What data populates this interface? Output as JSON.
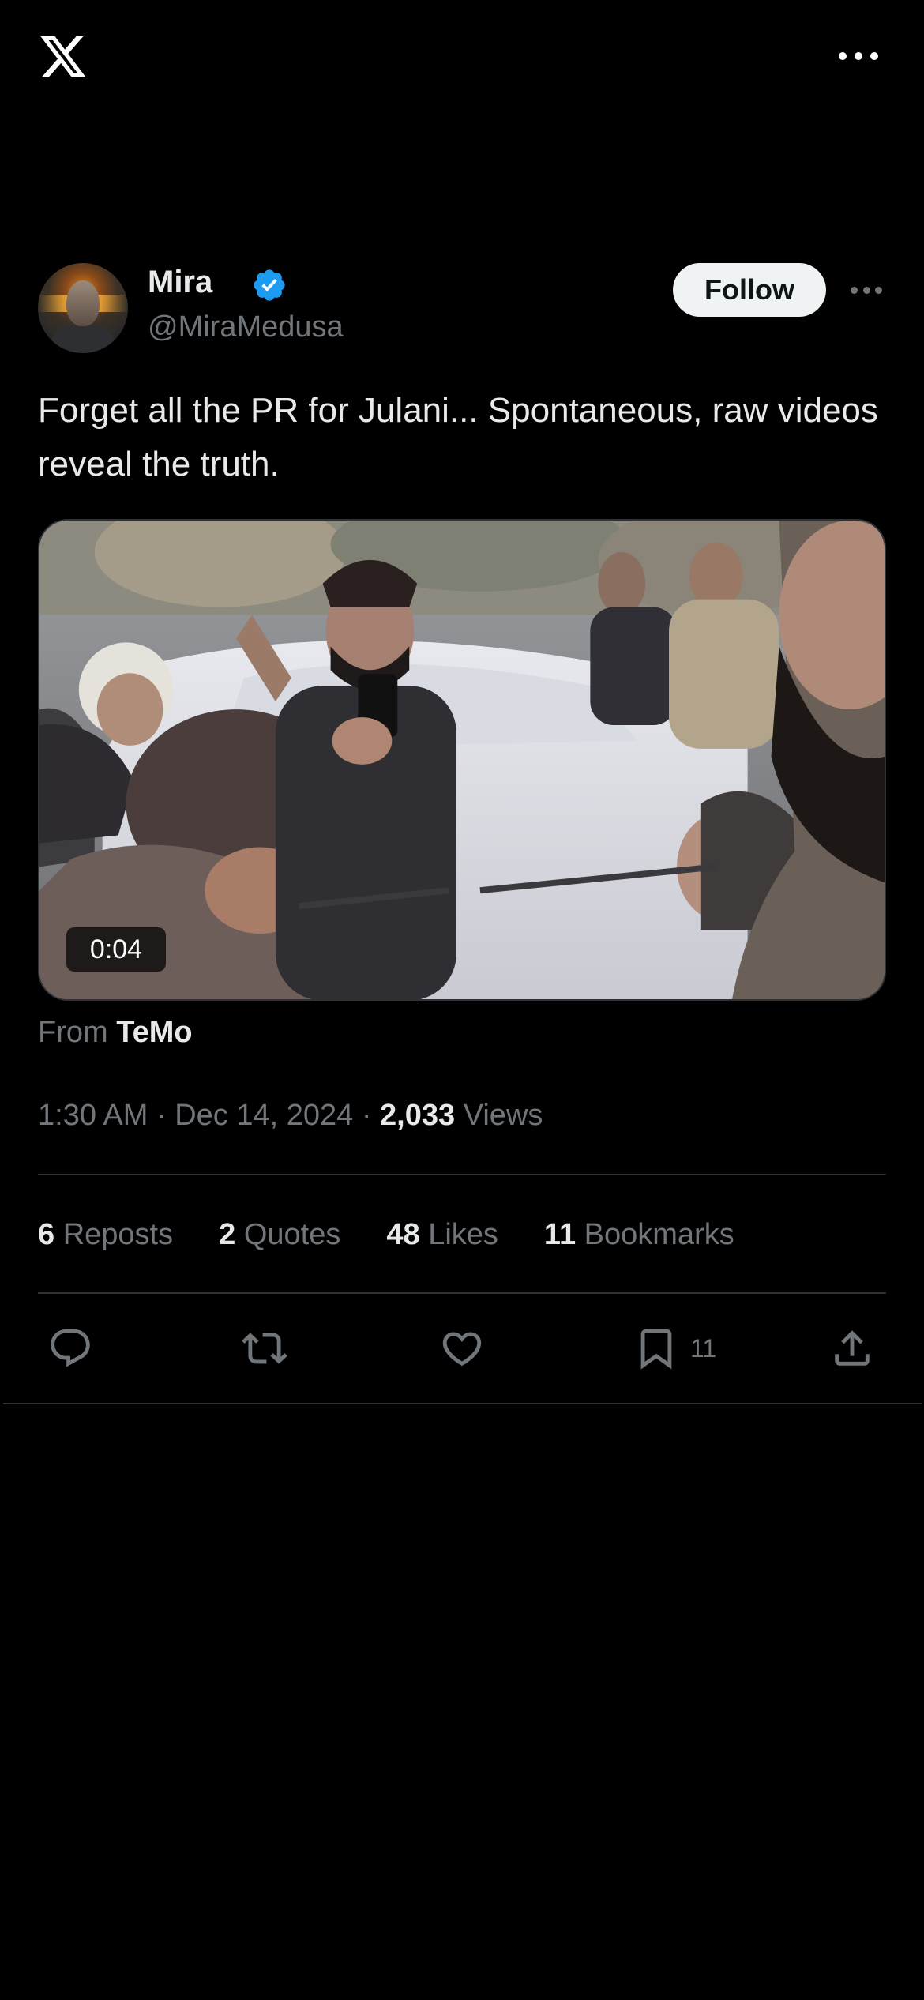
{
  "header": {
    "logo_icon": "x-logo-icon",
    "more_icon": "more-horizontal-icon"
  },
  "post": {
    "author": {
      "name": "Mira",
      "handle": "@MiraMedusa",
      "verified": true,
      "verified_color": "#1d9bf0"
    },
    "follow_label": "Follow",
    "text": "Forget all the PR for Julani... Spontaneous, raw videos reveal the truth.",
    "media": {
      "type": "video",
      "duration": "0:04"
    },
    "source": {
      "prefix": "From",
      "name": "TeMo"
    },
    "meta": {
      "time": "1:30 AM",
      "separator": "·",
      "date": "Dec 14, 2024",
      "views_count": "2,033",
      "views_label": "Views"
    },
    "stats": [
      {
        "count": "6",
        "label": "Reposts"
      },
      {
        "count": "2",
        "label": "Quotes"
      },
      {
        "count": "48",
        "label": "Likes"
      },
      {
        "count": "11",
        "label": "Bookmarks"
      }
    ],
    "actions": {
      "reply_icon": "reply-icon",
      "repost_icon": "repost-icon",
      "like_icon": "heart-icon",
      "bookmark_icon": "bookmark-icon",
      "bookmark_count": "11",
      "share_icon": "share-icon"
    }
  },
  "colors": {
    "background": "#000000",
    "text_primary": "#e7e9ea",
    "text_secondary": "#71767b",
    "divider": "#2f3336",
    "follow_bg": "#eff3f4"
  }
}
